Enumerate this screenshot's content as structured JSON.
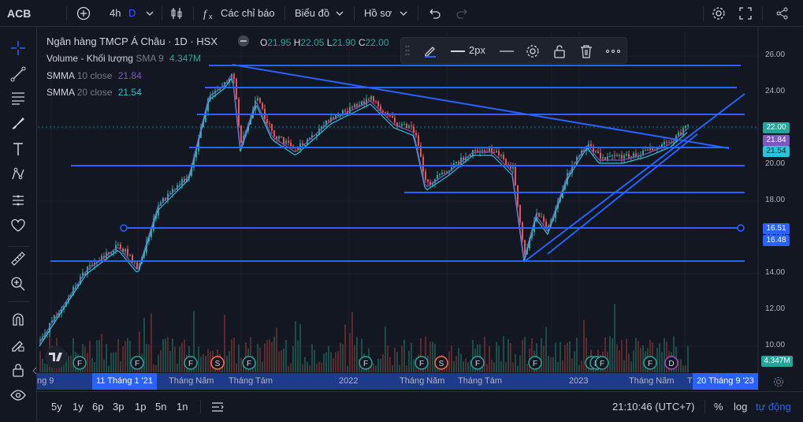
{
  "topbar": {
    "symbol": "ACB",
    "interval": "4h",
    "interval_extra": "D",
    "indicators_label": "Các chỉ báo",
    "template_label": "Biểu đồ",
    "profile_label": "Hồ sơ"
  },
  "legend": {
    "title": "Ngân hàng TMCP Á Châu · 1D · HSX",
    "o_label": "O",
    "o_value": "21.95",
    "h_label": "H",
    "h_value": "22.05",
    "l_label": "L",
    "l_value": "21.90",
    "c_label": "C",
    "c_value": "22.00",
    "volume_name": "Volume - Khối lượng",
    "volume_param": "SMA 9",
    "volume_value": "4.347M",
    "smma10_name": "SMMA",
    "smma10_param": "10 close",
    "smma10_value": "21.84",
    "smma20_name": "SMMA",
    "smma20_param": "20 close",
    "smma20_value": "21.54"
  },
  "drawing_toolbar": {
    "width_label": "2px"
  },
  "price_axis": {
    "ticks": [
      "26.00",
      "24.00",
      "22.00",
      "20.00",
      "18.00",
      "16.00",
      "14.00",
      "12.00",
      "10.00"
    ],
    "labels": {
      "last": "22.00",
      "smma10": "21.84",
      "smma20": "21.54",
      "line_a": "16.51",
      "line_b": "16.48",
      "volume": "4.347M"
    }
  },
  "time_axis": {
    "ticks": [
      "ng 9",
      "Tháng Năm",
      "Tháng Tám",
      "2022",
      "Tháng Năm",
      "Tháng Tám",
      "2023",
      "Tháng Năm",
      "T"
    ],
    "highlight_left": "11 Tháng 1 '21",
    "highlight_right": "20 Tháng 9 '23"
  },
  "bottombar": {
    "ranges": [
      "5y",
      "1y",
      "6p",
      "3p",
      "1p",
      "5n",
      "1n"
    ],
    "clock": "21:10:46 (UTC+7)",
    "percent": "%",
    "log": "log",
    "auto": "tự động"
  },
  "markers": [
    "F",
    "F",
    "F",
    "S",
    "F",
    "F",
    "F",
    "S",
    "F",
    "F",
    "F",
    "F",
    "F",
    "F",
    "D"
  ],
  "colors": {
    "background": "#131722",
    "up": "#26a69a",
    "down": "#ef5350",
    "drawing_lines": "#2962ff",
    "smma10": "#7e57c2",
    "smma20": "#26c6da",
    "volume_up": "#1b4d49",
    "volume_down": "#5c2a2b"
  }
}
